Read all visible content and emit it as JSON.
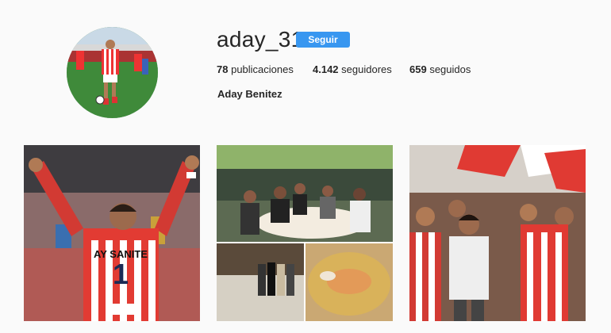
{
  "profile": {
    "username": "aday_31",
    "follow_label": "Seguir",
    "full_name": "Aday Benitez",
    "stats": {
      "posts_count": "78",
      "posts_label": "publicaciones",
      "followers_count": "4.142",
      "followers_label": "seguidores",
      "following_count": "659",
      "following_label": "seguidos"
    }
  },
  "colors": {
    "follow_button": "#3897f0",
    "background": "#fafafa",
    "text": "#262626"
  },
  "posts": [
    {
      "jersey_text": "AY SANITE"
    },
    {},
    {}
  ]
}
